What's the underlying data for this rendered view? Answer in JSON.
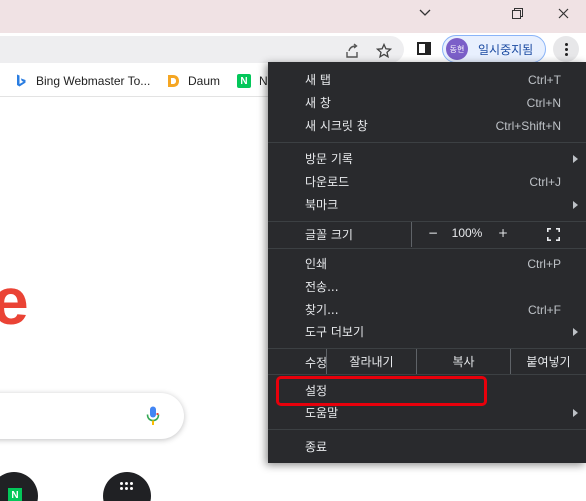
{
  "window": {
    "minimize_icon": "minimize-icon",
    "maximize_icon": "restore-icon",
    "close_icon": "close-icon"
  },
  "toolbar": {
    "profile": {
      "avatar_text": "동현",
      "label": "일시중지됨",
      "avatar_color": "#7b5fc8"
    }
  },
  "bookmarks": [
    {
      "label": "Bing Webmaster To...",
      "icon": "bing-icon",
      "icon_color": "#2a7de1"
    },
    {
      "label": "Daum",
      "icon": "daum-icon",
      "icon_color": "#f5a623"
    },
    {
      "label": "N",
      "icon": "naver-icon",
      "icon_color": "#03c75a"
    }
  ],
  "page": {
    "logo_letter": "e",
    "naver_tile": "N"
  },
  "menu": {
    "new_tab": {
      "label": "새 탭",
      "shortcut": "Ctrl+T"
    },
    "new_window": {
      "label": "새 창",
      "shortcut": "Ctrl+N"
    },
    "incognito": {
      "label": "새 시크릿 창",
      "shortcut": "Ctrl+Shift+N"
    },
    "history": {
      "label": "방문 기록"
    },
    "downloads": {
      "label": "다운로드",
      "shortcut": "Ctrl+J"
    },
    "bookmarks": {
      "label": "북마크"
    },
    "zoom": {
      "label": "글꼴 크기",
      "minus": "−",
      "value": "100%",
      "plus": "+"
    },
    "print": {
      "label": "인쇄",
      "shortcut": "Ctrl+P"
    },
    "cast": {
      "label": "전송..."
    },
    "find": {
      "label": "찾기...",
      "shortcut": "Ctrl+F"
    },
    "more_tools": {
      "label": "도구 더보기"
    },
    "edit": {
      "label": "수정",
      "cut": "잘라내기",
      "copy": "복사",
      "paste": "붙여넣기"
    },
    "settings": {
      "label": "설정"
    },
    "help": {
      "label": "도움말"
    },
    "exit": {
      "label": "종료"
    }
  },
  "colors": {
    "menu_bg": "#292a2d",
    "highlight": "#e8000b",
    "titlebar": "#f0e2e4"
  }
}
